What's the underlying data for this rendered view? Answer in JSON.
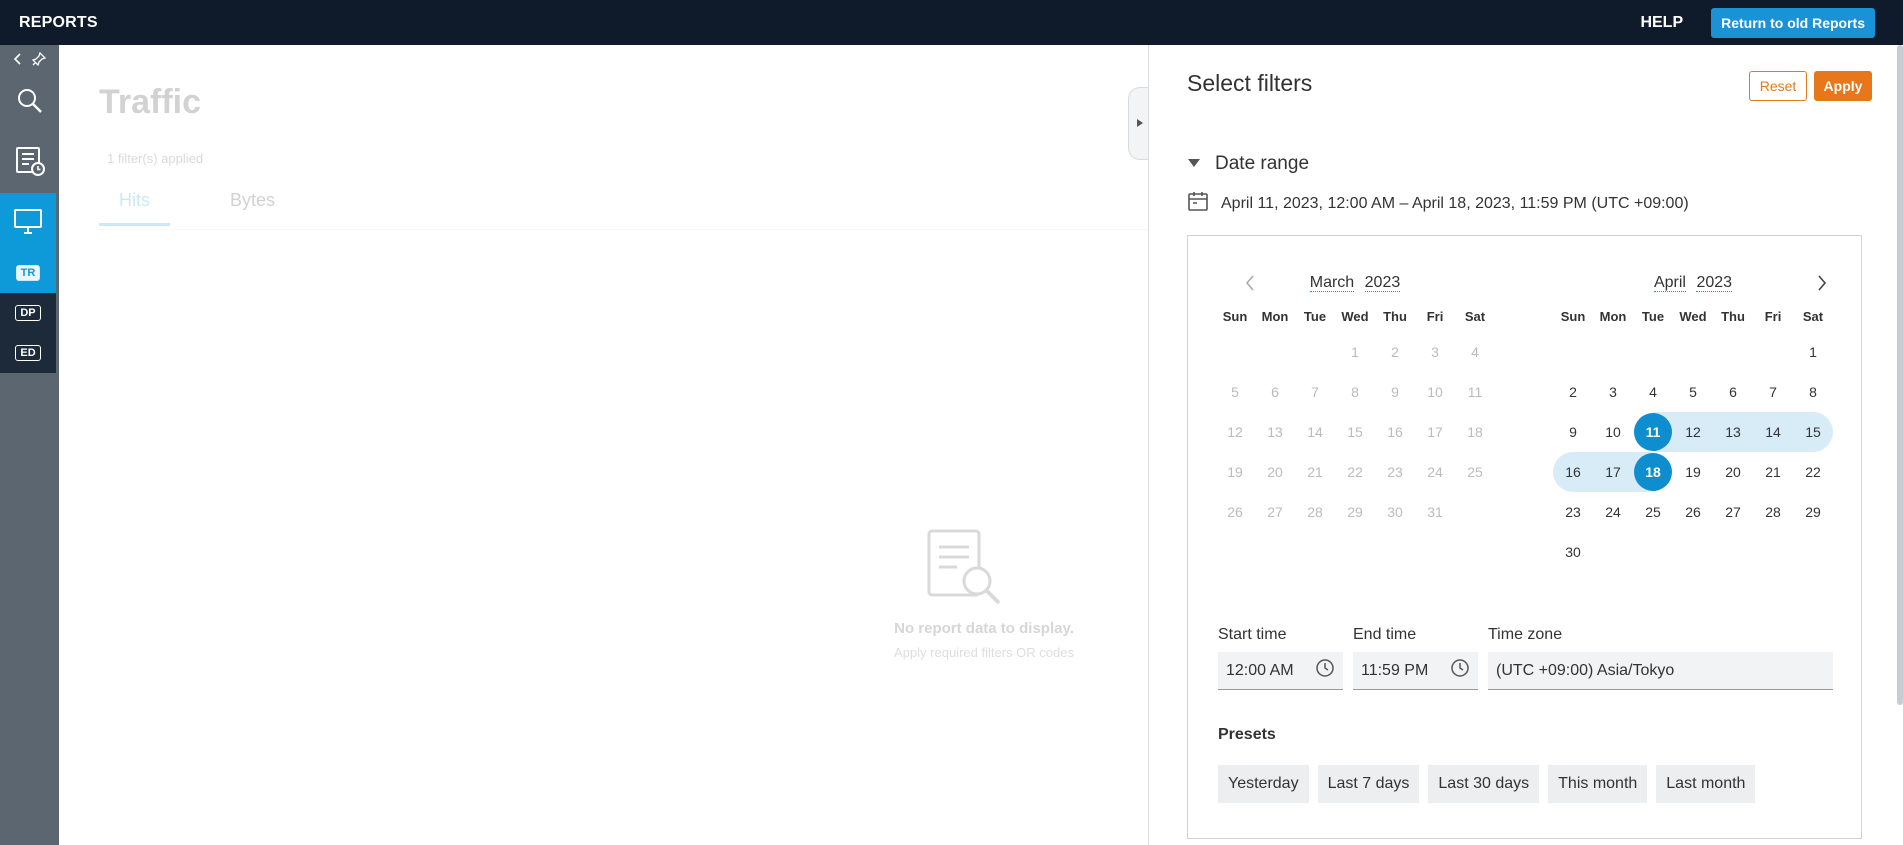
{
  "topbar": {
    "title": "REPORTS",
    "help_label": "HELP",
    "old_reports_label": "Return to old Reports"
  },
  "sidebar": {
    "tags": [
      "TR",
      "DP",
      "ED"
    ]
  },
  "main": {
    "title": "Traffic",
    "filters_applied": "1 filter(s) applied",
    "tabs": [
      "Hits",
      "Bytes"
    ],
    "empty_title": "No report data to display.",
    "empty_sub": "Apply required filters OR codes"
  },
  "panel": {
    "title": "Select filters",
    "reset_label": "Reset",
    "apply_label": "Apply",
    "section_label": "Date range",
    "range_text": "April 11, 2023, 12:00 AM – April 18, 2023, 11:59 PM (UTC +09:00)",
    "weekdays": [
      "Sun",
      "Mon",
      "Tue",
      "Wed",
      "Thu",
      "Fri",
      "Sat"
    ],
    "left_cal": {
      "month": "March",
      "year": "2023",
      "first_weekday": 3,
      "days": 31
    },
    "right_cal": {
      "month": "April",
      "year": "2023",
      "first_weekday": 6,
      "days": 30,
      "range_start": 11,
      "range_end": 18
    },
    "start_time_label": "Start time",
    "start_time_value": "12:00 AM",
    "end_time_label": "End time",
    "end_time_value": "11:59 PM",
    "timezone_label": "Time zone",
    "timezone_value": "(UTC +09:00) Asia/Tokyo",
    "presets_label": "Presets",
    "presets": [
      "Yesterday",
      "Last 7 days",
      "Last 30 days",
      "This month",
      "Last month"
    ]
  },
  "colors": {
    "accent": "#0e8ecf",
    "orange": "#e8761a",
    "topbar": "#0f1b2a",
    "sidebar": "#5b6670"
  }
}
